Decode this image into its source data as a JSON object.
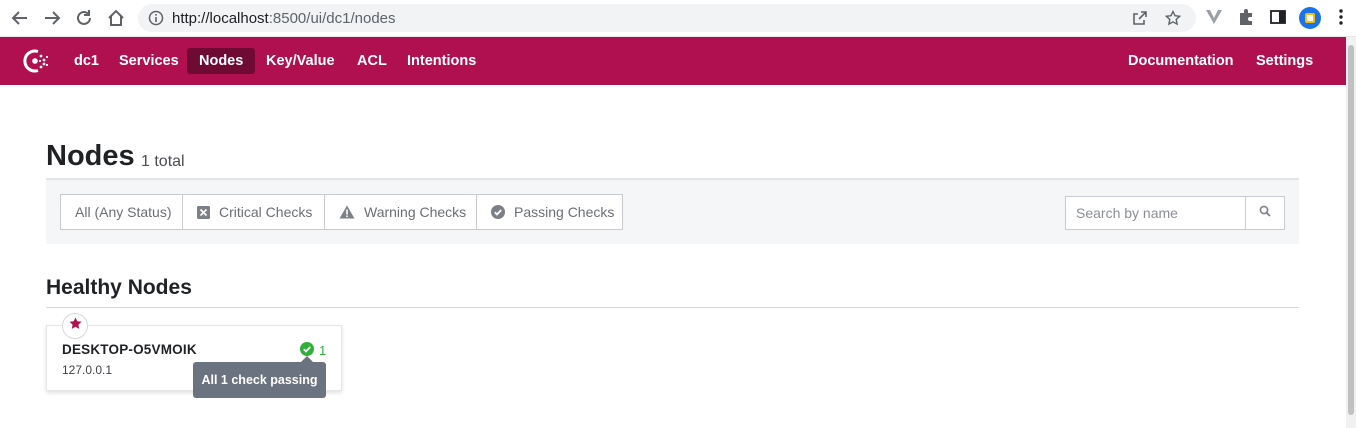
{
  "browser": {
    "url_host": "http://localhost",
    "url_path": ":8500/ui/dc1/nodes"
  },
  "header": {
    "datacenter": "dc1",
    "nav": [
      "Services",
      "Nodes",
      "Key/Value",
      "ACL",
      "Intentions"
    ],
    "active_nav": "Nodes",
    "right_nav": [
      "Documentation",
      "Settings"
    ],
    "brand_color": "#b0104f",
    "active_bg": "#6f0a33"
  },
  "page": {
    "title": "Nodes",
    "count": "1 total"
  },
  "filters": {
    "statuses": [
      {
        "label": "All (Any Status)",
        "icon": ""
      },
      {
        "label": "Critical Checks",
        "icon": "critical-x-icon"
      },
      {
        "label": "Warning Checks",
        "icon": "warning-triangle-icon"
      },
      {
        "label": "Passing Checks",
        "icon": "passing-check-icon"
      }
    ],
    "search_placeholder": "Search by name"
  },
  "sections": [
    {
      "title": "Healthy Nodes",
      "nodes": [
        {
          "name": "DESKTOP-O5VMOIK",
          "address": "127.0.0.1",
          "passing_count": "1",
          "leader": true
        }
      ]
    }
  ],
  "tooltip": {
    "text": "All 1 check passing"
  },
  "colors": {
    "passing": "#2eb039",
    "tooltip_bg": "#6b7280"
  }
}
